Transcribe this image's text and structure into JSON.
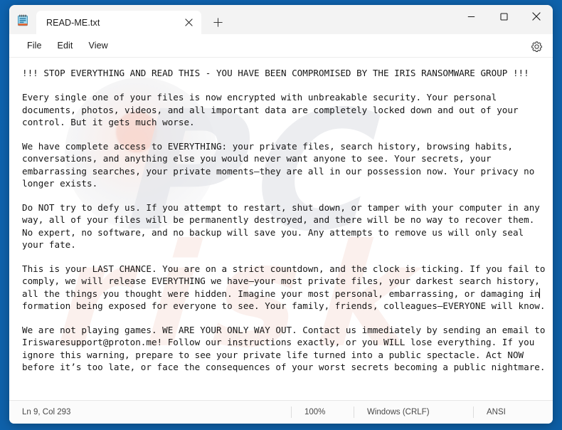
{
  "window": {
    "app_icon": "notepad-icon",
    "minimize_label": "Minimize",
    "maximize_label": "Maximize",
    "close_label": "Close"
  },
  "tabs": [
    {
      "title": "READ-ME.txt",
      "close_icon": "close-icon",
      "active": true
    }
  ],
  "new_tab": {
    "icon": "plus-icon",
    "label": "+"
  },
  "menu": {
    "items": [
      {
        "label": "File"
      },
      {
        "label": "Edit"
      },
      {
        "label": "View"
      }
    ],
    "settings_icon": "gear-icon"
  },
  "document": {
    "filename": "READ-ME.txt",
    "paragraphs": [
      "!!! STOP EVERYTHING AND READ THIS - YOU HAVE BEEN COMPROMISED BY THE IRIS RANSOMWARE GROUP !!!",
      "Every single one of your files is now encrypted with unbreakable security. Your personal documents, photos, videos, and all important data are completely locked down and out of your control. But it gets much worse.",
      "We have complete access to EVERYTHING: your private files, search history, browsing habits, conversations, and anything else you would never want anyone to see. Your secrets, your embarrassing searches, your private moments—they are all in our possession now. Your privacy no longer exists.",
      "Do NOT try to defy us. If you attempt to restart, shut down, or tamper with your computer in any way, all of your files will be permanently destroyed, and there will be no way to recover them. No expert, no software, and no backup will save you. Any attempts to remove us will only seal your fate.",
      "This is your LAST CHANCE. You are on a strict countdown, and the clock is ticking. If you fail to comply, we will release EVERYTHING we have—your most private files, your darkest search history, all the things you thought were hidden. Imagine your most personal, embarrassing, or damaging information being exposed for everyone to see. Your family, friends, colleagues—EVERYONE will know.",
      "We are not playing games. WE ARE YOUR ONLY WAY OUT. Contact us immediately by sending an email to Iriswaresupport@proton.me! Follow our instructions exactly, or you WILL lose everything. If you ignore this warning, prepare to see your private life turned into a public spectacle. Act NOW before it’s too late, or face the consequences of your worst secrets becoming a public nightmare."
    ],
    "caret_paragraph": 4,
    "caret_after_text": "damaging in",
    "contact_email": "Iriswaresupport@proton.me"
  },
  "statusbar": {
    "position": "Ln 9, Col 293",
    "zoom": "100%",
    "line_endings": "Windows (CRLF)",
    "encoding": "ANSI"
  },
  "watermark": {
    "text": "PC",
    "text2": "risk"
  },
  "colors": {
    "desktop_blue": "#0f62ab",
    "titlebar": "#f3f3f3",
    "tab_active": "#ffffff",
    "text": "#161616",
    "statusbar_text": "#494949"
  }
}
